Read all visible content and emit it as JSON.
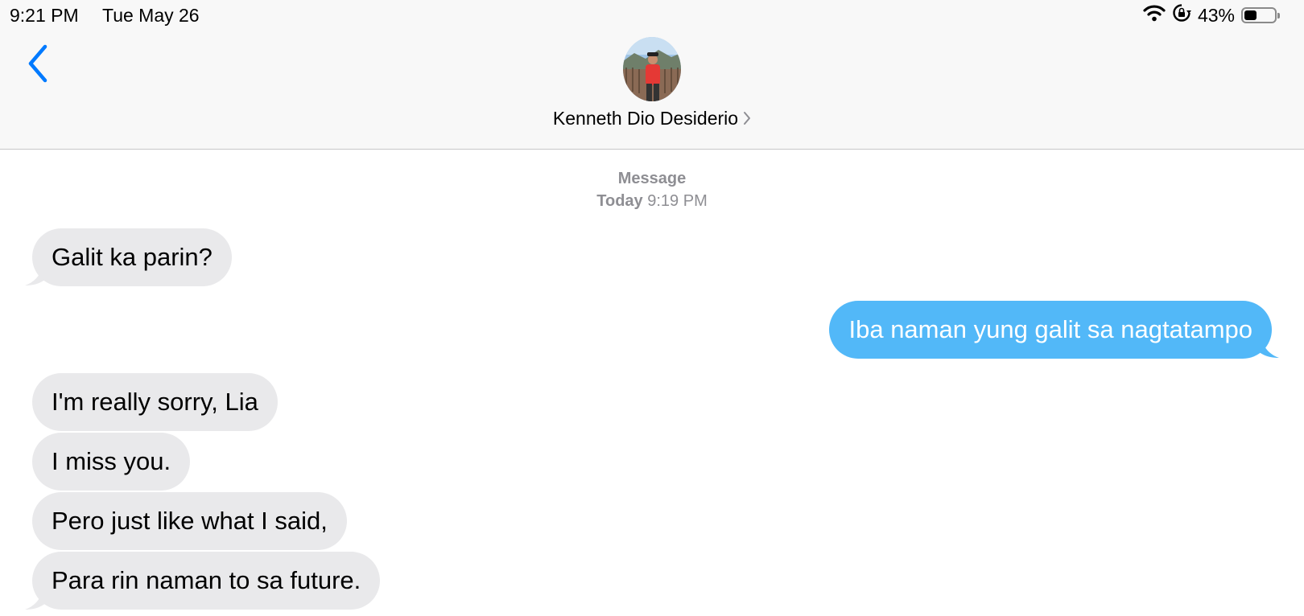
{
  "status_bar": {
    "time": "9:21 PM",
    "date": "Tue May 26",
    "battery_percent": "43%",
    "battery_level": 0.43,
    "icons": [
      "wifi-icon",
      "rotation-lock-icon",
      "battery-icon"
    ]
  },
  "nav": {
    "back_icon": "chevron-left-icon",
    "contact_name": "Kenneth Dio Desiderio",
    "avatar": "contact-photo"
  },
  "thread_header": {
    "service": "Message",
    "day": "Today",
    "time": "9:19 PM"
  },
  "colors": {
    "received_bubble": "#e9e9eb",
    "sent_bubble": "#52b8f8",
    "accent": "#007aff",
    "meta_text": "#8e8e93"
  },
  "messages": [
    {
      "direction": "received",
      "text": "Galit ka parin?"
    },
    {
      "direction": "sent",
      "text": "Iba naman yung galit sa nagtatampo"
    },
    {
      "direction": "received",
      "text": "I'm really sorry, Lia"
    },
    {
      "direction": "received",
      "text": "I miss you."
    },
    {
      "direction": "received",
      "text": "Pero just like what I said,"
    },
    {
      "direction": "received",
      "text": "Para rin naman to sa future."
    }
  ]
}
